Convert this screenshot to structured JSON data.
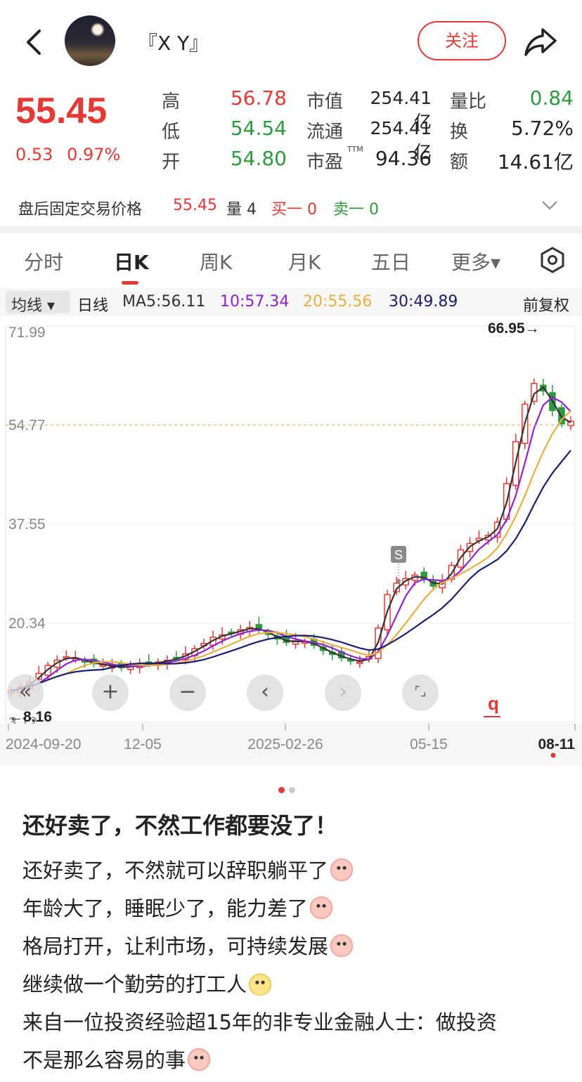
{
  "header": {
    "username": "『X Y』",
    "follow_label": "关注"
  },
  "quote": {
    "price": "55.45",
    "change": "0.53",
    "change_pct": "0.97%",
    "rows": [
      {
        "l1": "高",
        "v1": "56.78",
        "l2": "市值",
        "v2": "254.41亿",
        "l3": "量比",
        "v3": "0.84"
      },
      {
        "l1": "低",
        "v1": "54.54",
        "l2": "流通",
        "v2": "254.41亿",
        "l3": "换",
        "v3": "5.72%"
      },
      {
        "l1": "开",
        "v1": "54.80",
        "l2": "市盈",
        "v2": "94.36",
        "l3": "额",
        "v3": "14.61亿"
      }
    ],
    "ttm": "TTM"
  },
  "after_hours": {
    "label": "盘后固定交易价格",
    "price": "55.45",
    "volume": "量 4",
    "buy1": "买一 0",
    "sell1": "卖一 0"
  },
  "tabs": [
    "分时",
    "日K",
    "周K",
    "月K",
    "五日",
    "更多▾"
  ],
  "active_tab": "日K",
  "ma_bar": {
    "selector": "均线 ▾",
    "period": "日线",
    "ma5": "MA5:56.11",
    "ma10": "10:57.34",
    "ma20": "20:55.56",
    "ma30": "30:49.89",
    "adjust": "前复权"
  },
  "colors": {
    "up": "#e53935",
    "down": "#2e9a3e",
    "ma5": "#333333",
    "ma10": "#8e24d0",
    "ma20": "#e8b040",
    "ma30": "#1a1f6e"
  },
  "chart_data": {
    "type": "candlestick",
    "y_ticks": [
      "71.99",
      "54.77",
      "37.55",
      "20.34",
      "3.12"
    ],
    "ylim": [
      3.12,
      71.99
    ],
    "x_ticks": [
      "2024-09-20",
      "12-05",
      "2025-02-26",
      "05-15",
      "08-11"
    ],
    "high_marker": "66.95→",
    "low_marker": "←8.16",
    "signal_label": "S",
    "right_marker": "q",
    "current_price_line": 54.77,
    "closes": [
      8.6,
      9.2,
      10.1,
      11.6,
      13.0,
      13.9,
      14.5,
      14.2,
      13.6,
      13.3,
      13.1,
      12.8,
      12.6,
      12.9,
      13.1,
      13.3,
      13.6,
      13.9,
      14.3,
      15.0,
      15.9,
      16.8,
      17.9,
      18.3,
      18.7,
      19.2,
      19.6,
      19.1,
      18.4,
      17.6,
      17.0,
      17.3,
      17.1,
      16.5,
      15.6,
      14.9,
      14.3,
      13.9,
      13.6,
      14.5,
      19.5,
      25.3,
      27.3,
      28.1,
      28.7,
      27.9,
      26.8,
      27.5,
      30.4,
      33.1,
      34.2,
      35.1,
      35.6,
      37.9,
      44.6,
      51.9,
      58.4,
      62.0,
      60.7,
      57.3,
      55.0,
      55.45
    ]
  },
  "controls": {
    "collapse": "«",
    "zoom_in": "+",
    "zoom_out": "−",
    "prev": "‹",
    "next": "›",
    "fullscreen": "⌜⌟"
  },
  "post": {
    "title": "还好卖了，不然工作都要没了！",
    "lines": [
      "还好卖了，不然就可以辞职躺平了",
      "年龄大了，睡眠少了，能力差了",
      "格局打开，让利市场，可持续发展",
      "继续做一个勤劳的打工人",
      "来自一位投资经验超15年的非专业金融人士：做投资",
      "不是那么容易的事"
    ]
  }
}
